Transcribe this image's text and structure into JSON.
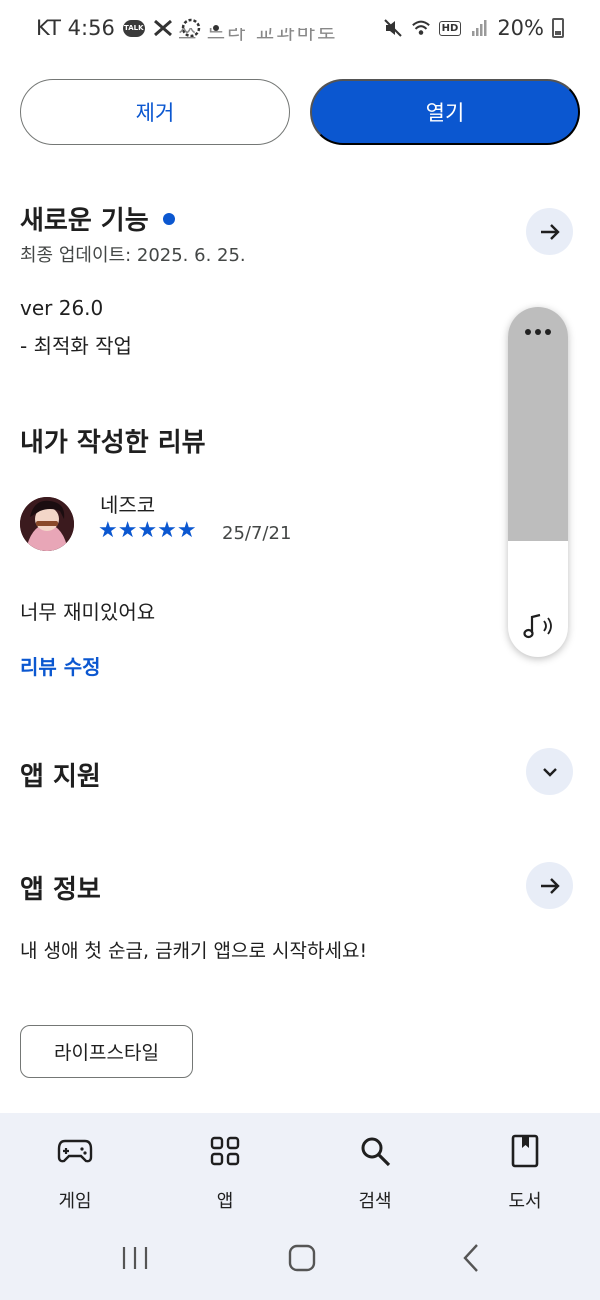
{
  "status_bar": {
    "carrier_time": "KT 4:56",
    "talk_badge": "TALK",
    "battery": "20%",
    "hd_badge": "HD",
    "obscured_text": "쓰 드라 교과바로"
  },
  "actions": {
    "remove_label": "제거",
    "open_label": "열기"
  },
  "whats_new": {
    "title": "새로운 기능",
    "last_updated": "최종 업데이트: 2025. 6. 25.",
    "version": "ver 26.0",
    "note": "- 최적화 작업"
  },
  "my_review": {
    "title": "내가 작성한 리뷰",
    "reviewer": "네즈코",
    "rating_stars": 5,
    "stars": "★★★★★",
    "date": "25/7/21",
    "text": "너무 재미있어요",
    "edit_link": "리뷰 수정"
  },
  "app_support": {
    "title": "앱 지원"
  },
  "app_info": {
    "title": "앱 정보",
    "description": "내 생애 첫 순금, 금캐기 앱으로 시작하세요!",
    "category_chip": "라이프스타일"
  },
  "volume_overlay": {
    "level_percent": 33
  },
  "bottom_nav": {
    "items": [
      {
        "label": "게임",
        "icon": "gamepad-icon"
      },
      {
        "label": "앱",
        "icon": "apps-grid-icon"
      },
      {
        "label": "검색",
        "icon": "search-icon"
      },
      {
        "label": "도서",
        "icon": "book-icon"
      }
    ]
  },
  "colors": {
    "accent": "#0b57d0",
    "nav_background": "#eef1f8",
    "circle_button": "#e8edf7"
  }
}
